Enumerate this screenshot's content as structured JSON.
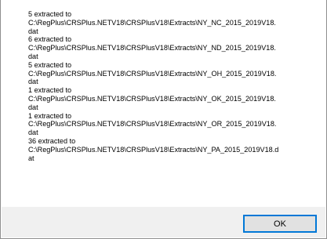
{
  "dialog": {
    "message": "5 extracted to\nC:\\RegPlus\\CRSPlus.NETV18\\CRSPlusV18\\Extracts\\NY_NC_2015_2019V18.\ndat\n6 extracted to\nC:\\RegPlus\\CRSPlus.NETV18\\CRSPlusV18\\Extracts\\NY_ND_2015_2019V18.\ndat\n5 extracted to\nC:\\RegPlus\\CRSPlus.NETV18\\CRSPlusV18\\Extracts\\NY_OH_2015_2019V18.\ndat\n1 extracted to\nC:\\RegPlus\\CRSPlus.NETV18\\CRSPlusV18\\Extracts\\NY_OK_2015_2019V18.\ndat\n1 extracted to\nC:\\RegPlus\\CRSPlus.NETV18\\CRSPlusV18\\Extracts\\NY_OR_2015_2019V18.\ndat\n36 extracted to\nC:\\RegPlus\\CRSPlus.NETV18\\CRSPlusV18\\Extracts\\NY_PA_2015_2019V18.d\nat",
    "ok_label": "OK"
  },
  "colors": {
    "background": "#ffffff",
    "button_bar": "#f0f0f0",
    "button_face": "#e1e1e1",
    "focus_border": "#0078d7",
    "frame": "#8f8f8f"
  }
}
